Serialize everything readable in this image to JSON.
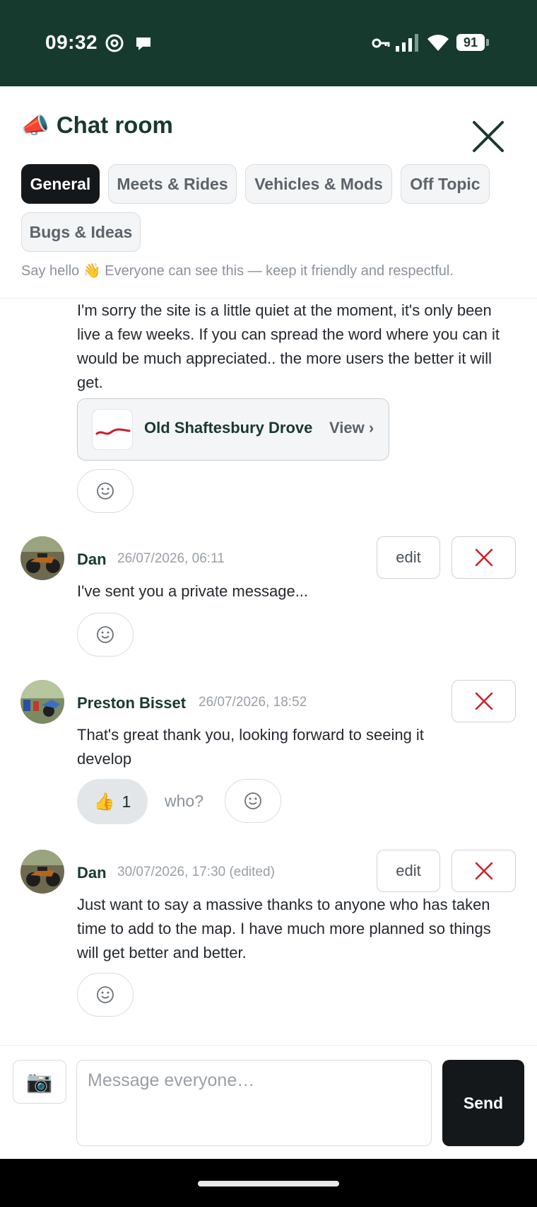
{
  "status_bar": {
    "time": "09:32",
    "battery": "91",
    "icons": [
      "threads-icon",
      "chat-bubble-icon",
      "vpn-key-icon",
      "signal-icon",
      "wifi-icon",
      "battery-icon"
    ]
  },
  "header": {
    "icon": "megaphone-icon",
    "icon_glyph": "📣",
    "title": "Chat room",
    "close_icon": "close-icon",
    "subtitle": "Say hello 👋 Everyone can see this — keep it friendly and respectful."
  },
  "tabs": [
    {
      "label": "General",
      "active": true
    },
    {
      "label": "Meets & Rides",
      "active": false
    },
    {
      "label": "Vehicles & Mods",
      "active": false
    },
    {
      "label": "Off Topic",
      "active": false
    },
    {
      "label": "Bugs & Ideas",
      "active": false
    }
  ],
  "messages": [
    {
      "text": "I'm sorry the site is a little quiet at the moment, it's only been live a few weeks. If you can spread the word where you can it would be much appreciated..  the more users the better it will get.",
      "route": {
        "name": "Old Shaftesbury Drove",
        "view_label": "View ›"
      }
    },
    {
      "author": "Dan",
      "timestamp": "26/07/2026, 06:11",
      "edit_label": "edit",
      "text": "I've sent you a private message..."
    },
    {
      "author": "Preston Bisset",
      "timestamp": "26/07/2026, 18:52",
      "text": "That's great thank you, looking forward to seeing it develop",
      "reaction": {
        "emoji": "👍",
        "count": "1"
      },
      "who_label": "who?"
    },
    {
      "author": "Dan",
      "timestamp": "30/07/2026, 17:30 (edited)",
      "edit_label": "edit",
      "text": "Just want to say a massive thanks to anyone who has taken time to add to the map. I have much more planned so things will get better and better."
    }
  ],
  "composer": {
    "camera_glyph": "📷",
    "placeholder": "Message everyone…",
    "send_label": "Send"
  },
  "colors": {
    "brand_dark": "#173a2f",
    "delete_red": "#d0202a",
    "button_dark": "#15181b"
  }
}
